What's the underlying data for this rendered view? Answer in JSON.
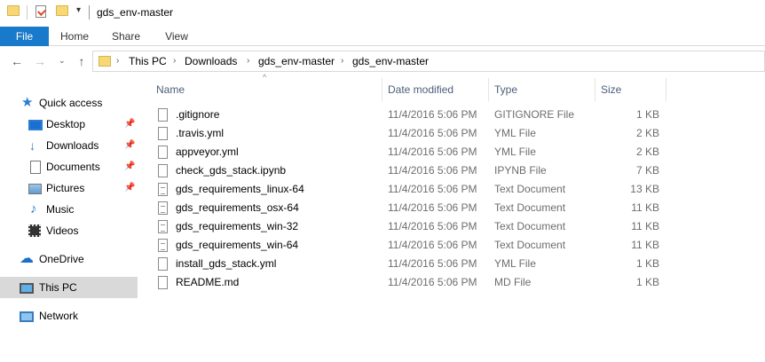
{
  "window": {
    "title": "gds_env-master",
    "quick_access_toolbar": {
      "icons": [
        "folder-icon",
        "properties-icon",
        "new-folder-icon",
        "customize-caret-icon"
      ]
    }
  },
  "ribbon": {
    "tabs": [
      "File",
      "Home",
      "Share",
      "View"
    ]
  },
  "address_bar": {
    "nav": {
      "back": "←",
      "forward": "→",
      "recent": "⌄",
      "up": "↑"
    },
    "breadcrumbs": [
      "This PC",
      "Downloads",
      "gds_env-master",
      "gds_env-master"
    ],
    "separator": "›"
  },
  "nav_pane": {
    "items": [
      {
        "label": "Quick access",
        "icon": "star-icon",
        "pinned": false
      },
      {
        "label": "Desktop",
        "icon": "desktop-icon",
        "pinned": true
      },
      {
        "label": "Downloads",
        "icon": "download-arrow-icon",
        "pinned": true
      },
      {
        "label": "Documents",
        "icon": "documents-icon",
        "pinned": true
      },
      {
        "label": "Pictures",
        "icon": "pictures-icon",
        "pinned": true
      },
      {
        "label": "Music",
        "icon": "music-note-icon",
        "pinned": false
      },
      {
        "label": "Videos",
        "icon": "videos-icon",
        "pinned": false
      },
      {
        "label": "OneDrive",
        "icon": "cloud-icon",
        "pinned": false
      },
      {
        "label": "This PC",
        "icon": "computer-icon",
        "pinned": false,
        "selected": true
      },
      {
        "label": "Network",
        "icon": "network-icon",
        "pinned": false
      }
    ]
  },
  "file_list": {
    "columns": {
      "name": "Name",
      "date": "Date modified",
      "type": "Type",
      "size": "Size"
    },
    "sort_glyph": "^",
    "rows": [
      {
        "name": ".gitignore",
        "date": "11/4/2016 5:06 PM",
        "type": "GITIGNORE File",
        "size": "1 KB",
        "icon": "blank-file-icon"
      },
      {
        "name": ".travis.yml",
        "date": "11/4/2016 5:06 PM",
        "type": "YML File",
        "size": "2 KB",
        "icon": "blank-file-icon"
      },
      {
        "name": "appveyor.yml",
        "date": "11/4/2016 5:06 PM",
        "type": "YML File",
        "size": "2 KB",
        "icon": "blank-file-icon"
      },
      {
        "name": "check_gds_stack.ipynb",
        "date": "11/4/2016 5:06 PM",
        "type": "IPYNB File",
        "size": "7 KB",
        "icon": "blank-file-icon"
      },
      {
        "name": "gds_requirements_linux-64",
        "date": "11/4/2016 5:06 PM",
        "type": "Text Document",
        "size": "13 KB",
        "icon": "text-file-icon"
      },
      {
        "name": "gds_requirements_osx-64",
        "date": "11/4/2016 5:06 PM",
        "type": "Text Document",
        "size": "11 KB",
        "icon": "text-file-icon"
      },
      {
        "name": "gds_requirements_win-32",
        "date": "11/4/2016 5:06 PM",
        "type": "Text Document",
        "size": "11 KB",
        "icon": "text-file-icon"
      },
      {
        "name": "gds_requirements_win-64",
        "date": "11/4/2016 5:06 PM",
        "type": "Text Document",
        "size": "11 KB",
        "icon": "text-file-icon"
      },
      {
        "name": "install_gds_stack.yml",
        "date": "11/4/2016 5:06 PM",
        "type": "YML File",
        "size": "1 KB",
        "icon": "blank-file-icon"
      },
      {
        "name": "README.md",
        "date": "11/4/2016 5:06 PM",
        "type": "MD File",
        "size": "1 KB",
        "icon": "blank-file-icon"
      }
    ]
  },
  "colors": {
    "file_tab": "#1979ca",
    "selected_nav": "#d9d9d9",
    "header_text": "#4c607a",
    "muted_text": "#6d6d6d",
    "folder": "#f8d775"
  }
}
